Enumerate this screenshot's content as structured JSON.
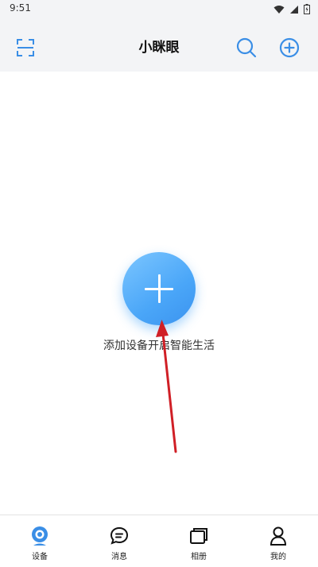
{
  "status_bar": {
    "time": "9:51"
  },
  "header": {
    "title": "小眯眼"
  },
  "main": {
    "hint": "添加设备开启智能生活"
  },
  "tabs": [
    {
      "label": "设备",
      "icon": "camera-icon",
      "active": true
    },
    {
      "label": "消息",
      "icon": "chat-bubble-icon",
      "active": false
    },
    {
      "label": "相册",
      "icon": "album-icon",
      "active": false
    },
    {
      "label": "我的",
      "icon": "person-icon",
      "active": false
    }
  ],
  "colors": {
    "accent": "#3a8ee6",
    "button_gradient_start": "#7cc6ff",
    "button_gradient_end": "#3b93ef",
    "arrow": "#d01f26",
    "header_bg": "#f3f4f6"
  }
}
